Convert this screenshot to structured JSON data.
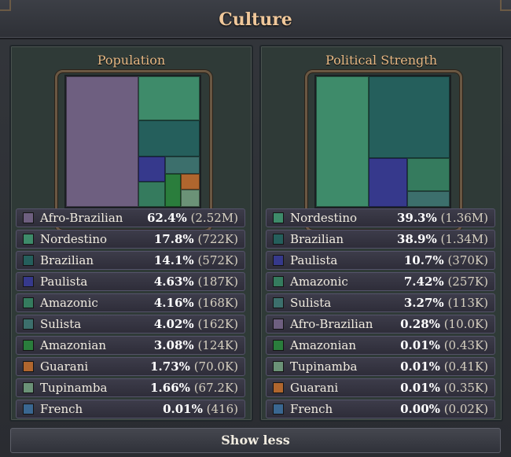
{
  "window": {
    "title": "Culture"
  },
  "colors": {
    "Afro-Brazilian": "#6e5f80",
    "Nordestino": "#3e8b6a",
    "Brazilian": "#255f5c",
    "Paulista": "#36398c",
    "Amazonic": "#357b5e",
    "Sulista": "#3c6f6c",
    "Amazonian": "#2a7d3c",
    "Guarani": "#b0662e",
    "Tupinamba": "#6b9277",
    "French": "#3a6791"
  },
  "population": {
    "title": "Population",
    "rows": [
      {
        "name": "Afro-Brazilian",
        "pct": "62.4%",
        "abs": "(2.52M)"
      },
      {
        "name": "Nordestino",
        "pct": "17.8%",
        "abs": "(722K)"
      },
      {
        "name": "Brazilian",
        "pct": "14.1%",
        "abs": "(572K)"
      },
      {
        "name": "Paulista",
        "pct": "4.63%",
        "abs": "(187K)"
      },
      {
        "name": "Amazonic",
        "pct": "4.16%",
        "abs": "(168K)"
      },
      {
        "name": "Sulista",
        "pct": "4.02%",
        "abs": "(162K)"
      },
      {
        "name": "Amazonian",
        "pct": "3.08%",
        "abs": "(124K)"
      },
      {
        "name": "Guarani",
        "pct": "1.73%",
        "abs": "(70.0K)"
      },
      {
        "name": "Tupinamba",
        "pct": "1.66%",
        "abs": "(67.2K)"
      },
      {
        "name": "French",
        "pct": "0.01%",
        "abs": "(416)"
      }
    ]
  },
  "political": {
    "title": "Political Strength",
    "rows": [
      {
        "name": "Nordestino",
        "pct": "39.3%",
        "abs": "(1.36M)"
      },
      {
        "name": "Brazilian",
        "pct": "38.9%",
        "abs": "(1.34M)"
      },
      {
        "name": "Paulista",
        "pct": "10.7%",
        "abs": "(370K)"
      },
      {
        "name": "Amazonic",
        "pct": "7.42%",
        "abs": "(257K)"
      },
      {
        "name": "Sulista",
        "pct": "3.27%",
        "abs": "(113K)"
      },
      {
        "name": "Afro-Brazilian",
        "pct": "0.28%",
        "abs": "(10.0K)"
      },
      {
        "name": "Amazonian",
        "pct": "0.01%",
        "abs": "(0.43K)"
      },
      {
        "name": "Tupinamba",
        "pct": "0.01%",
        "abs": "(0.41K)"
      },
      {
        "name": "Guarani",
        "pct": "0.01%",
        "abs": "(0.35K)"
      },
      {
        "name": "French",
        "pct": "0.00%",
        "abs": "(0.02K)"
      }
    ]
  },
  "footer": {
    "show_less_label": "Show less"
  }
}
